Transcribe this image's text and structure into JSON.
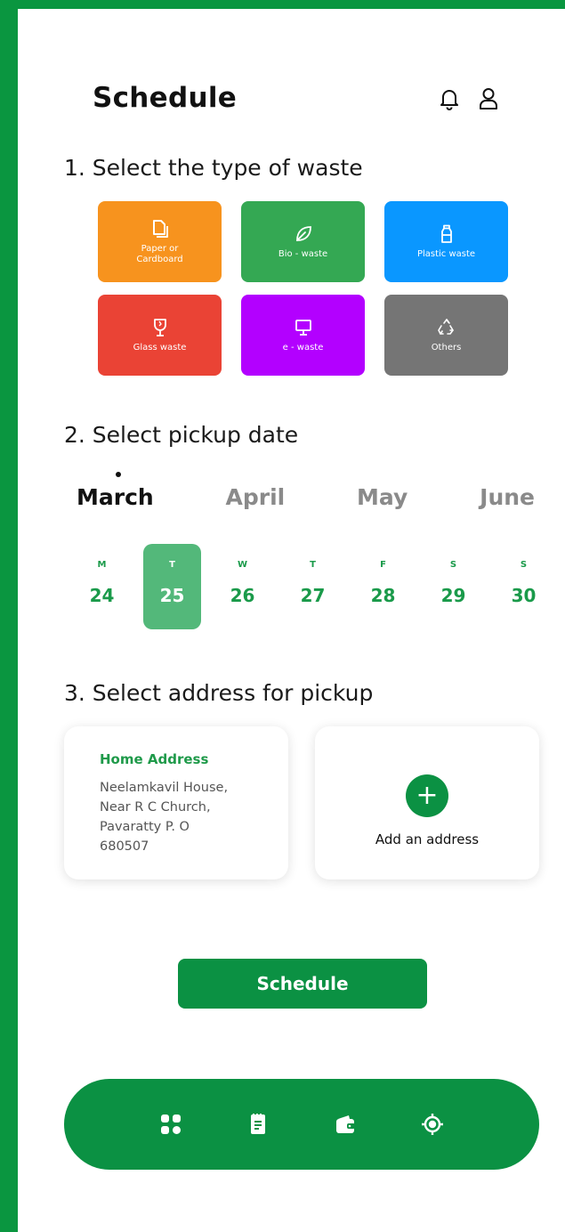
{
  "header": {
    "title": "Schedule",
    "icons": [
      "bell-icon",
      "user-icon"
    ]
  },
  "sections": {
    "waste_type": "1. Select the type of waste",
    "pickup_date": "2. Select pickup date",
    "address": "3. Select address for pickup"
  },
  "waste_types": [
    {
      "label": "Paper or\nCardboard",
      "color": "#f7931e",
      "icon": "document-icon"
    },
    {
      "label": "Bio - waste",
      "color": "#34a853",
      "icon": "leaf-icon"
    },
    {
      "label": "Plastic waste",
      "color": "#0a97ff",
      "icon": "bottle-icon"
    },
    {
      "label": "Glass waste",
      "color": "#ea4335",
      "icon": "glass-icon"
    },
    {
      "label": "e - waste",
      "color": "#b300ff",
      "icon": "monitor-icon"
    },
    {
      "label": "Others",
      "color": "#757575",
      "icon": "recycle-icon"
    }
  ],
  "months": [
    "March",
    "April",
    "May",
    "June"
  ],
  "active_month": "March",
  "days": [
    {
      "name": "M",
      "num": "24"
    },
    {
      "name": "T",
      "num": "25",
      "selected": true
    },
    {
      "name": "W",
      "num": "26"
    },
    {
      "name": "T",
      "num": "27"
    },
    {
      "name": "F",
      "num": "28"
    },
    {
      "name": "S",
      "num": "29"
    },
    {
      "name": "S",
      "num": "30"
    }
  ],
  "home_address": {
    "title": "Home Address",
    "lines": [
      "Neelamkavil House,",
      "Near R C Church,",
      "Pavaratty P. O",
      "680507"
    ]
  },
  "add_address": {
    "label": "Add an address",
    "plus": "+"
  },
  "schedule_button": "Schedule",
  "bottom_nav": [
    "dashboard-icon",
    "notes-icon",
    "wallet-icon",
    "location-icon"
  ],
  "colors": {
    "brand": "#0b9143",
    "background": "#0a9640",
    "selected_day": "#53b87a"
  }
}
